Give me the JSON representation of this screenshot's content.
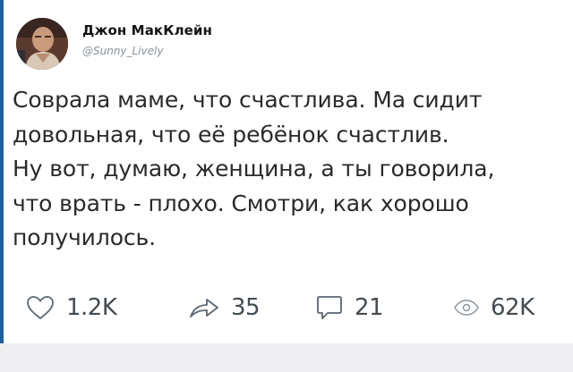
{
  "tweet": {
    "author": {
      "display_name": "Джон МакКлейн",
      "handle": "@Sunny_Lively",
      "avatar": "profile-photo"
    },
    "text": "Соврала маме, что счастлива. Ма сидит\nдовольная, что её ребёнок счастлив.\nНу вот, думаю, женщина, а ты говорила,\nчто врать - плохо. Смотри, как хорошо\nполучилось.",
    "stats": {
      "likes": "1.2K",
      "retweets": "35",
      "replies": "21",
      "views": "62K"
    },
    "icons": {
      "like": "heart-icon",
      "retweet": "share-arrow-icon",
      "reply": "speech-bubble-icon",
      "views": "eye-icon"
    },
    "colors": {
      "accent_bar": "#1f5f9e",
      "text": "#2a2a2a",
      "icon": "#4e5a64"
    }
  }
}
